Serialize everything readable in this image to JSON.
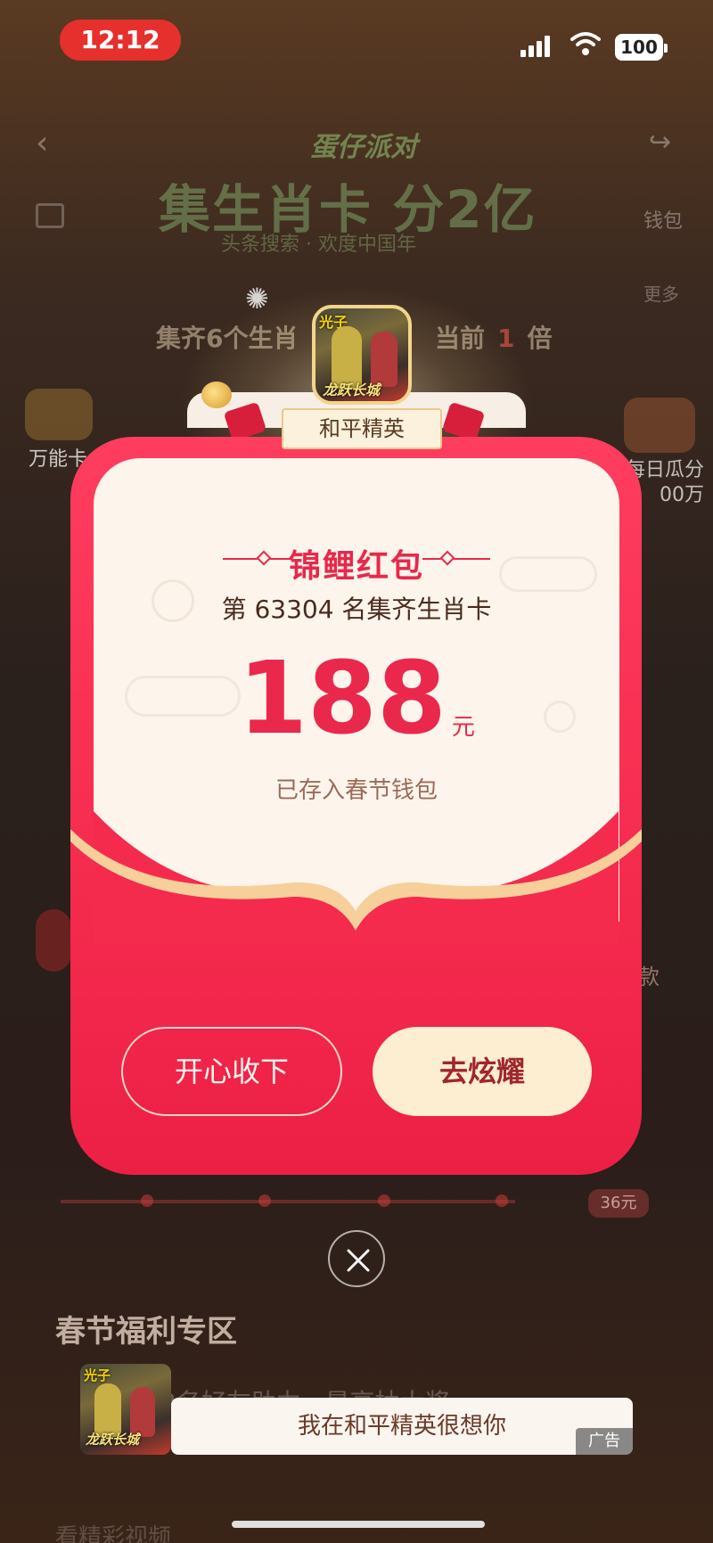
{
  "status_bar": {
    "time": "12:12",
    "battery": "100"
  },
  "background": {
    "brand": "蛋仔派对",
    "title": "集生肖卡 分2亿",
    "subtitle": "头条搜索 · 欢度中国年",
    "wallet_label": "钱包",
    "more_label": "更多",
    "collect_text": "集齐6个生肖",
    "current_label": "当前",
    "current_multiplier": "1",
    "multiplier_unit": "倍",
    "wanneng_label": "万能卡",
    "daily_label_line1": "每日瓜分",
    "daily_label_line2": "00万",
    "right_badge": "款",
    "progress_badge": "36元",
    "section_title": "春节福利专区",
    "row_faded": "3名好友助力 · 最高抽大奖",
    "bottom_row": "看精彩视频"
  },
  "modal": {
    "game_name": "和平精英",
    "game_icon_tag": "光子",
    "game_icon_logo": "龙跃长城",
    "title": "锦鲤红包",
    "rank_text": "第 63304 名集齐生肖卡",
    "amount": "188",
    "unit": "元",
    "saved_text": "已存入春节钱包",
    "accept_button": "开心收下",
    "share_button": "去炫耀"
  },
  "ad": {
    "text": "我在和平精英很想你",
    "tag": "广告",
    "icon_tag": "光子",
    "icon_logo": "龙跃长城"
  },
  "colors": {
    "accent_red": "#ea284b",
    "modal_red": "#f52b4e",
    "card_cream": "#fdf5ec",
    "share_button_bg": "#fdeed2"
  }
}
